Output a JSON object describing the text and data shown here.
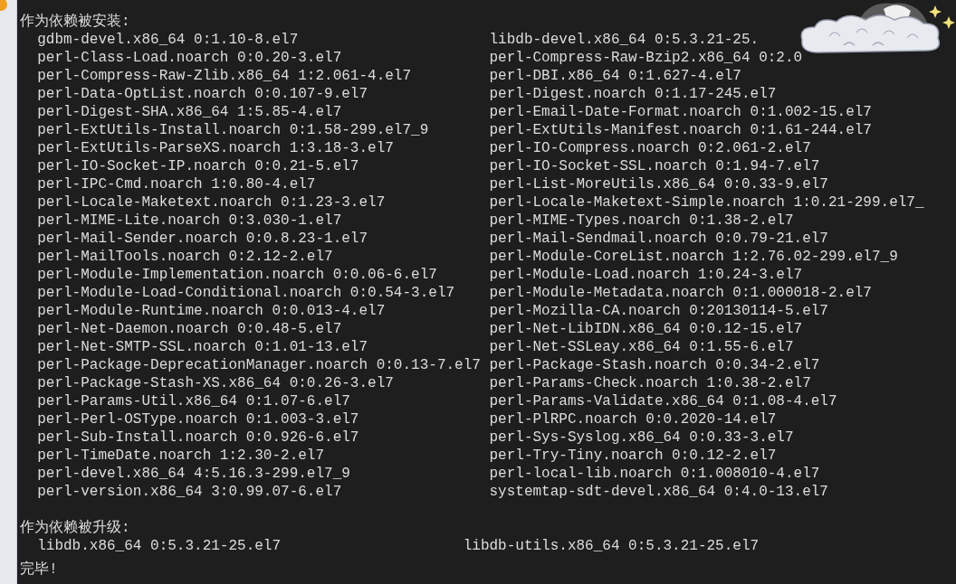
{
  "terminal": {
    "sections": [
      {
        "heading": "作为依赖被安装:",
        "rows": [
          {
            "column_1": "gdbm-devel.x86_64 0:1.10-8.el7",
            "column_2": "libdb-devel.x86_64 0:5.3.21-25."
          },
          {
            "column_1": "perl-Class-Load.noarch 0:0.20-3.el7",
            "column_2": "perl-Compress-Raw-Bzip2.x86_64 0:2.0"
          },
          {
            "column_1": "perl-Compress-Raw-Zlib.x86_64 1:2.061-4.el7",
            "column_2": "perl-DBI.x86_64 0:1.627-4.el7"
          },
          {
            "column_1": "perl-Data-OptList.noarch 0:0.107-9.el7",
            "column_2": "perl-Digest.noarch 0:1.17-245.el7"
          },
          {
            "column_1": "perl-Digest-SHA.x86_64 1:5.85-4.el7",
            "column_2": "perl-Email-Date-Format.noarch 0:1.002-15.el7"
          },
          {
            "column_1": "perl-ExtUtils-Install.noarch 0:1.58-299.el7_9",
            "column_2": "perl-ExtUtils-Manifest.noarch 0:1.61-244.el7"
          },
          {
            "column_1": "perl-ExtUtils-ParseXS.noarch 1:3.18-3.el7",
            "column_2": "perl-IO-Compress.noarch 0:2.061-2.el7"
          },
          {
            "column_1": "perl-IO-Socket-IP.noarch 0:0.21-5.el7",
            "column_2": "perl-IO-Socket-SSL.noarch 0:1.94-7.el7"
          },
          {
            "column_1": "perl-IPC-Cmd.noarch 1:0.80-4.el7",
            "column_2": "perl-List-MoreUtils.x86_64 0:0.33-9.el7"
          },
          {
            "column_1": "perl-Locale-Maketext.noarch 0:1.23-3.el7",
            "column_2": "perl-Locale-Maketext-Simple.noarch 1:0.21-299.el7_"
          },
          {
            "column_1": "perl-MIME-Lite.noarch 0:3.030-1.el7",
            "column_2": "perl-MIME-Types.noarch 0:1.38-2.el7"
          },
          {
            "column_1": "perl-Mail-Sender.noarch 0:0.8.23-1.el7",
            "column_2": "perl-Mail-Sendmail.noarch 0:0.79-21.el7"
          },
          {
            "column_1": "perl-MailTools.noarch 0:2.12-2.el7",
            "column_2": "perl-Module-CoreList.noarch 1:2.76.02-299.el7_9"
          },
          {
            "column_1": "perl-Module-Implementation.noarch 0:0.06-6.el7",
            "column_2": "perl-Module-Load.noarch 1:0.24-3.el7"
          },
          {
            "column_1": "perl-Module-Load-Conditional.noarch 0:0.54-3.el7",
            "column_2": "perl-Module-Metadata.noarch 0:1.000018-2.el7"
          },
          {
            "column_1": "perl-Module-Runtime.noarch 0:0.013-4.el7",
            "column_2": "perl-Mozilla-CA.noarch 0:20130114-5.el7"
          },
          {
            "column_1": "perl-Net-Daemon.noarch 0:0.48-5.el7",
            "column_2": "perl-Net-LibIDN.x86_64 0:0.12-15.el7"
          },
          {
            "column_1": "perl-Net-SMTP-SSL.noarch 0:1.01-13.el7",
            "column_2": "perl-Net-SSLeay.x86_64 0:1.55-6.el7"
          },
          {
            "column_1": "perl-Package-DeprecationManager.noarch 0:0.13-7.el7",
            "column_2": "perl-Package-Stash.noarch 0:0.34-2.el7"
          },
          {
            "column_1": "perl-Package-Stash-XS.x86_64 0:0.26-3.el7",
            "column_2": "perl-Params-Check.noarch 1:0.38-2.el7"
          },
          {
            "column_1": "perl-Params-Util.x86_64 0:1.07-6.el7",
            "column_2": "perl-Params-Validate.x86_64 0:1.08-4.el7"
          },
          {
            "column_1": "perl-Perl-OSType.noarch 0:1.003-3.el7",
            "column_2": "perl-PlRPC.noarch 0:0.2020-14.el7"
          },
          {
            "column_1": "perl-Sub-Install.noarch 0:0.926-6.el7",
            "column_2": "perl-Sys-Syslog.x86_64 0:0.33-3.el7"
          },
          {
            "column_1": "perl-TimeDate.noarch 1:2.30-2.el7",
            "column_2": "perl-Try-Tiny.noarch 0:0.12-2.el7"
          },
          {
            "column_1": "perl-devel.x86_64 4:5.16.3-299.el7_9",
            "column_2": "perl-local-lib.noarch 0:1.008010-4.el7"
          },
          {
            "column_1": "perl-version.x86_64 3:0.99.07-6.el7",
            "column_2": "systemtap-sdt-devel.x86_64 0:4.0-13.el7"
          }
        ]
      },
      {
        "heading": "作为依赖被升级:",
        "rows": [
          {
            "column_1": "libdb.x86_64 0:5.3.21-25.el7",
            "column_2": "libdb-utils.x86_64 0:5.3.21-25.el7"
          }
        ]
      }
    ],
    "footer": "完毕!"
  }
}
